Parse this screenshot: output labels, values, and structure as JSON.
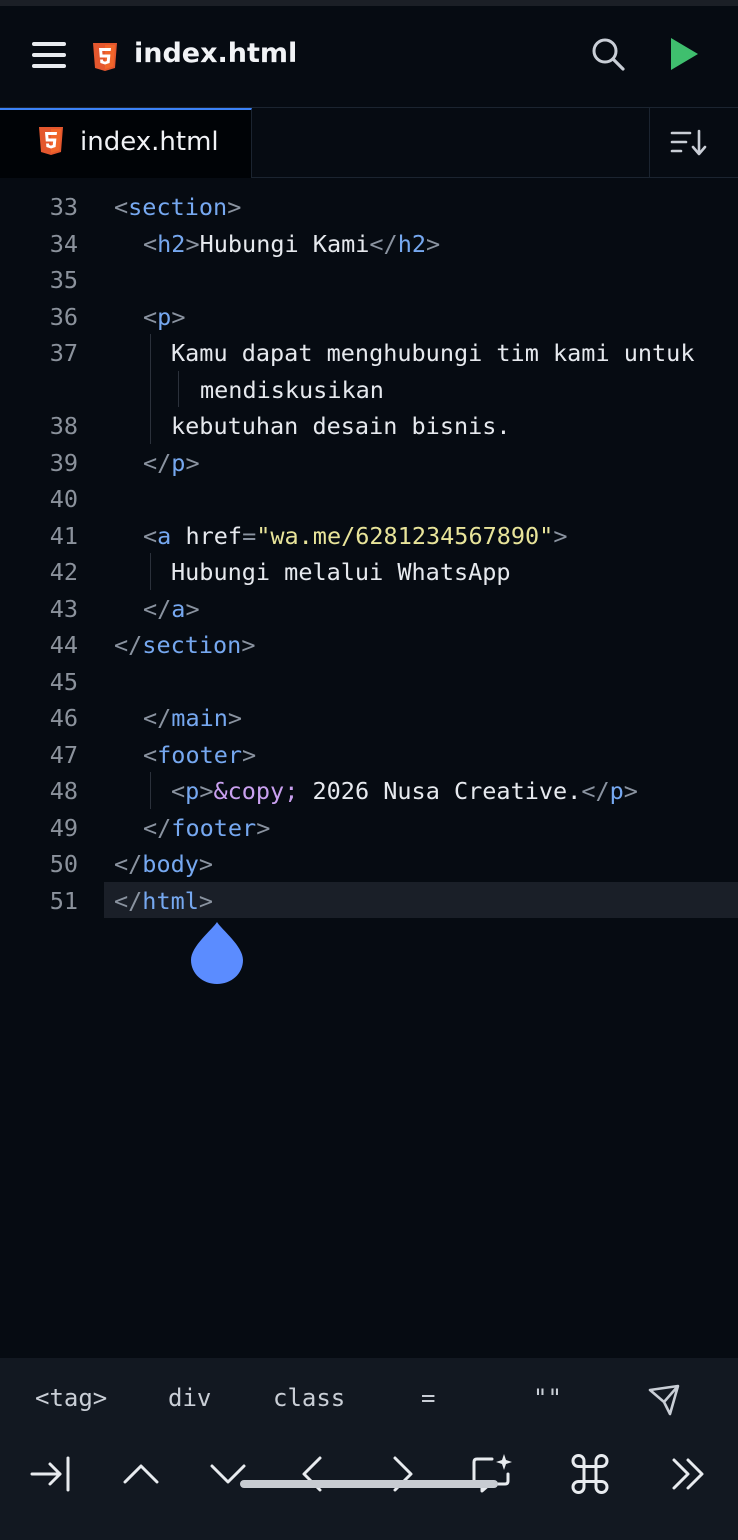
{
  "app_bar": {
    "title": "index.html",
    "icons": [
      "menu-icon",
      "html5-icon",
      "search-icon",
      "run-icon"
    ]
  },
  "tab_bar": {
    "active_tab": "index.html",
    "sort_icon": "sort-icon"
  },
  "colors": {
    "background": "#060b12",
    "tag": "#76a8f0",
    "punctuation": "#8a93a0",
    "string": "#e8e49a",
    "entity": "#c9a0ef",
    "text": "#e6e9ee",
    "html5": "#e4572e",
    "run": "#3fbf6e",
    "cursor_handle": "#5b8cff",
    "active_line": "#1a1f28"
  },
  "editor": {
    "active_line": "51",
    "lines": [
      {
        "n": "33",
        "tokens": [
          {
            "c": "p",
            "t": "<"
          },
          {
            "c": "t",
            "t": "section"
          },
          {
            "c": "p",
            "t": ">"
          }
        ]
      },
      {
        "n": "34",
        "tokens": [
          {
            "c": "p",
            "t": "<"
          },
          {
            "c": "t",
            "t": "h2"
          },
          {
            "c": "p",
            "t": ">"
          },
          {
            "c": "tx",
            "t": "Hubungi Kami"
          },
          {
            "c": "p",
            "t": "</"
          },
          {
            "c": "t",
            "t": "h2"
          },
          {
            "c": "p",
            "t": ">"
          }
        ]
      },
      {
        "n": "35",
        "tokens": []
      },
      {
        "n": "36",
        "tokens": [
          {
            "c": "p",
            "t": "<"
          },
          {
            "c": "t",
            "t": "p"
          },
          {
            "c": "p",
            "t": ">"
          }
        ]
      },
      {
        "n": "37",
        "tokens": [
          {
            "c": "tx",
            "t": "Kamu dapat menghubungi tim kami untuk"
          }
        ]
      },
      {
        "n": "",
        "tokens": [
          {
            "c": "tx",
            "t": "mendiskusikan"
          }
        ]
      },
      {
        "n": "38",
        "tokens": [
          {
            "c": "tx",
            "t": "kebutuhan desain bisnis."
          }
        ]
      },
      {
        "n": "39",
        "tokens": [
          {
            "c": "p",
            "t": "</"
          },
          {
            "c": "t",
            "t": "p"
          },
          {
            "c": "p",
            "t": ">"
          }
        ]
      },
      {
        "n": "40",
        "tokens": []
      },
      {
        "n": "41",
        "tokens": [
          {
            "c": "p",
            "t": "<"
          },
          {
            "c": "t",
            "t": "a"
          },
          {
            "c": "a",
            "t": " href"
          },
          {
            "c": "p",
            "t": "="
          },
          {
            "c": "s",
            "t": "\"wa.me/6281234567890\""
          },
          {
            "c": "p",
            "t": ">"
          }
        ]
      },
      {
        "n": "42",
        "tokens": [
          {
            "c": "tx",
            "t": "Hubungi melalui WhatsApp"
          }
        ]
      },
      {
        "n": "43",
        "tokens": [
          {
            "c": "p",
            "t": "</"
          },
          {
            "c": "t",
            "t": "a"
          },
          {
            "c": "p",
            "t": ">"
          }
        ]
      },
      {
        "n": "44",
        "tokens": [
          {
            "c": "p",
            "t": "</"
          },
          {
            "c": "t",
            "t": "section"
          },
          {
            "c": "p",
            "t": ">"
          }
        ]
      },
      {
        "n": "45",
        "tokens": []
      },
      {
        "n": "46",
        "tokens": [
          {
            "c": "p",
            "t": "</"
          },
          {
            "c": "t",
            "t": "main"
          },
          {
            "c": "p",
            "t": ">"
          }
        ]
      },
      {
        "n": "47",
        "tokens": [
          {
            "c": "p",
            "t": "<"
          },
          {
            "c": "t",
            "t": "footer"
          },
          {
            "c": "p",
            "t": ">"
          }
        ]
      },
      {
        "n": "48",
        "tokens": [
          {
            "c": "p",
            "t": "<"
          },
          {
            "c": "t",
            "t": "p"
          },
          {
            "c": "p",
            "t": ">"
          },
          {
            "c": "e",
            "t": "&copy;"
          },
          {
            "c": "tx",
            "t": " 2026 Nusa Creative."
          },
          {
            "c": "p",
            "t": "</"
          },
          {
            "c": "t",
            "t": "p"
          },
          {
            "c": "p",
            "t": ">"
          }
        ]
      },
      {
        "n": "49",
        "tokens": [
          {
            "c": "p",
            "t": "</"
          },
          {
            "c": "t",
            "t": "footer"
          },
          {
            "c": "p",
            "t": ">"
          }
        ]
      },
      {
        "n": "50",
        "tokens": [
          {
            "c": "p",
            "t": "</"
          },
          {
            "c": "t",
            "t": "body"
          },
          {
            "c": "p",
            "t": ">"
          }
        ]
      },
      {
        "n": "51",
        "tokens": [
          {
            "c": "p",
            "t": "</"
          },
          {
            "c": "t",
            "t": "html"
          },
          {
            "c": "p",
            "t": ">"
          }
        ]
      }
    ]
  },
  "snippet_bar": {
    "items": [
      "<tag>",
      "div",
      "class",
      "=",
      "\"\""
    ],
    "send_icon": "send-icon"
  },
  "key_bar": {
    "keys": [
      "tab-key-icon",
      "arrow-up-icon",
      "arrow-down-icon",
      "arrow-left-icon",
      "arrow-right-icon",
      "ai-chat-icon",
      "command-icon",
      "more-keys-icon"
    ]
  }
}
